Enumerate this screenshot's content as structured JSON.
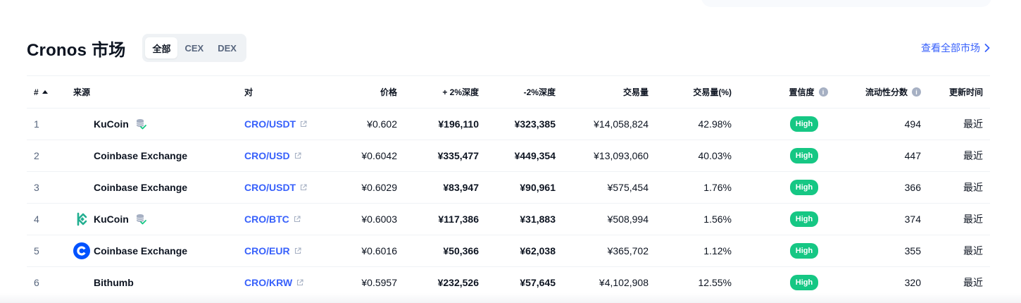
{
  "header": {
    "title": "Cronos 市场",
    "tabs": [
      "全部",
      "CEX",
      "DEX"
    ],
    "active_tab": "全部",
    "view_all_label": "查看全部市场"
  },
  "columns": {
    "num": "#",
    "source": "来源",
    "pair": "对",
    "price": "价格",
    "plus_depth": "+ 2%深度",
    "minus_depth": "-2%深度",
    "volume": "交易量",
    "volume_pct": "交易量(%)",
    "confidence": "置信度",
    "liquidity": "流动性分数",
    "updated": "更新时间"
  },
  "rows": [
    {
      "num": "1",
      "source": "KuCoin",
      "pair": "CRO/USDT",
      "price": "¥0.602",
      "plus_depth": "¥196,110",
      "minus_depth": "¥323,385",
      "volume": "¥14,058,824",
      "volume_pct": "42.98%",
      "confidence": "High",
      "liquidity": "494",
      "updated": "最近"
    },
    {
      "num": "2",
      "source": "Coinbase Exchange",
      "pair": "CRO/USD",
      "price": "¥0.6042",
      "plus_depth": "¥335,477",
      "minus_depth": "¥449,354",
      "volume": "¥13,093,060",
      "volume_pct": "40.03%",
      "confidence": "High",
      "liquidity": "447",
      "updated": "最近"
    },
    {
      "num": "3",
      "source": "Coinbase Exchange",
      "pair": "CRO/USDT",
      "price": "¥0.6029",
      "plus_depth": "¥83,947",
      "minus_depth": "¥90,961",
      "volume": "¥575,454",
      "volume_pct": "1.76%",
      "confidence": "High",
      "liquidity": "366",
      "updated": "最近"
    },
    {
      "num": "4",
      "source": "KuCoin",
      "pair": "CRO/BTC",
      "price": "¥0.6003",
      "plus_depth": "¥117,386",
      "minus_depth": "¥31,883",
      "volume": "¥508,994",
      "volume_pct": "1.56%",
      "confidence": "High",
      "liquidity": "374",
      "updated": "最近"
    },
    {
      "num": "5",
      "source": "Coinbase Exchange",
      "pair": "CRO/EUR",
      "price": "¥0.6016",
      "plus_depth": "¥50,366",
      "minus_depth": "¥62,038",
      "volume": "¥365,702",
      "volume_pct": "1.12%",
      "confidence": "High",
      "liquidity": "355",
      "updated": "最近"
    },
    {
      "num": "6",
      "source": "Bithumb",
      "pair": "CRO/KRW",
      "price": "¥0.5957",
      "plus_depth": "¥232,526",
      "minus_depth": "¥57,645",
      "volume": "¥4,102,908",
      "volume_pct": "12.55%",
      "confidence": "High",
      "liquidity": "320",
      "updated": "最近"
    }
  ],
  "colors": {
    "accent": "#3861fb",
    "high_badge": "#16c784",
    "kucoin": "#23af91",
    "coinbase": "#0052ff"
  }
}
